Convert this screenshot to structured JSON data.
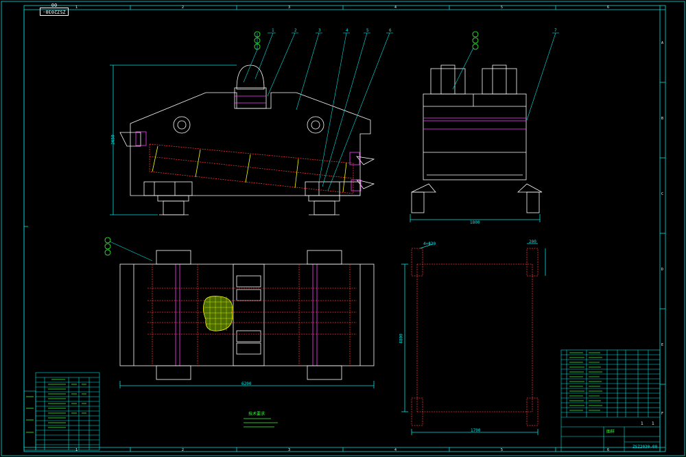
{
  "drawing_code": "ZSZ2030-00",
  "title_block": {
    "part_code": "ZSZ2030-00",
    "name_label": "图样",
    "sheet_marks": [
      "1",
      "1"
    ]
  },
  "tech_notes_title": "技术要求",
  "frame_numbers_top": [
    "1",
    "2",
    "3",
    "4",
    "5",
    "6"
  ],
  "frame_numbers_bottom": [
    "1",
    "2",
    "3",
    "4",
    "5",
    "6"
  ],
  "frame_letters_right": [
    "A",
    "B",
    "C",
    "D",
    "E",
    "F"
  ],
  "balloons_front": [
    "1",
    "2",
    "3",
    "4",
    "5",
    "6"
  ],
  "balloon_side": "7",
  "dim_labels": {
    "front_height": "2650",
    "side_width": "1800",
    "plan_length": "6200",
    "base_width": "1700",
    "base_length": "4800",
    "base_hole": "4×Φ30",
    "base_pad": "200"
  },
  "colors": {
    "line_cyan": "#00e5e5",
    "line_white": "#ffffff",
    "line_red": "#ff3030",
    "line_magenta": "#ff40ff",
    "line_yellow": "#ffff00",
    "line_green": "#39ff39"
  }
}
